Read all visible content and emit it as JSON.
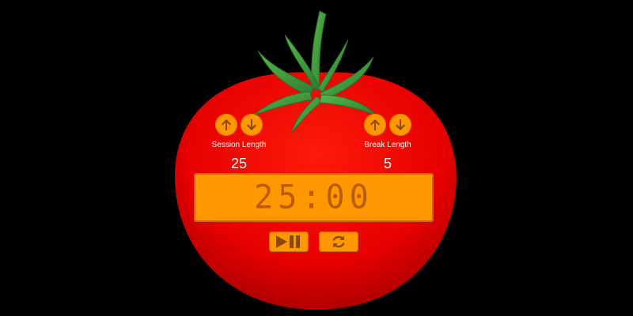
{
  "colors": {
    "background": "#000000",
    "tomato": "#e00000",
    "stem": "#3b9b3b",
    "accent": "#ff9800",
    "accent_dark": "#b85c00"
  },
  "session": {
    "label": "Session Length",
    "value": "25",
    "increase_icon": "arrow-up-icon",
    "decrease_icon": "arrow-down-icon"
  },
  "break": {
    "label": "Break Length",
    "value": "5",
    "increase_icon": "arrow-up-icon",
    "decrease_icon": "arrow-down-icon"
  },
  "timer": {
    "display": "25:00"
  },
  "controls": {
    "play_pause_icon": "play-pause-icon",
    "reset_icon": "reset-icon"
  }
}
